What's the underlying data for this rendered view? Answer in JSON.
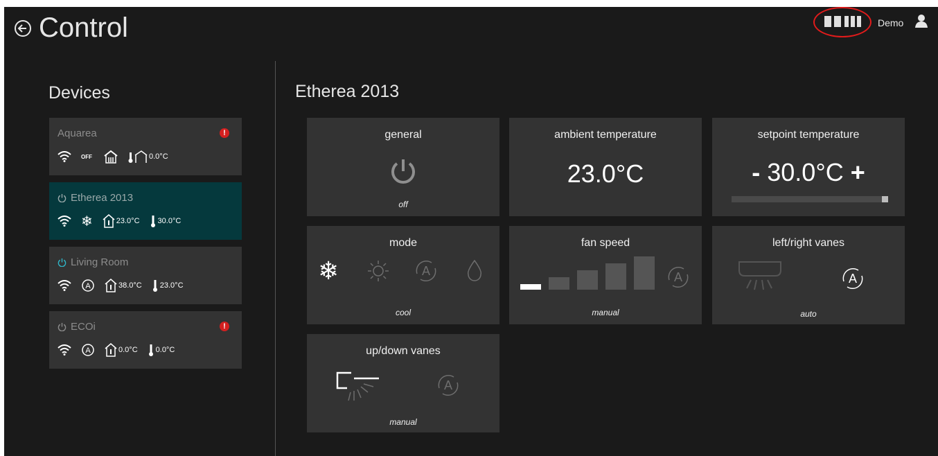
{
  "header": {
    "title": "Control",
    "back_icon": "back-arrow-circle-icon",
    "layout_icons": [
      "two-column-layout-icon",
      "three-column-layout-icon"
    ],
    "user_name": "Demo",
    "user_icon": "user-icon"
  },
  "sidebar": {
    "heading": "Devices",
    "devices": [
      {
        "name": "Aquarea",
        "alert": "!",
        "power_icon": false,
        "status": {
          "wifi": true,
          "mode": "OFF",
          "house_icon": "heat-house-icon",
          "indoor_temp": "0.0°C"
        }
      },
      {
        "name": "Etherea 2013",
        "alert": "",
        "power_icon": true,
        "selected": true,
        "status": {
          "wifi": true,
          "mode_icon": "snowflake-icon",
          "ambient_temp": "23.0°C",
          "setpoint_temp": "30.0°C"
        }
      },
      {
        "name": "Living Room",
        "alert": "",
        "power_icon": true,
        "power_on": true,
        "status": {
          "wifi": true,
          "mode_icon": "auto-mode-icon",
          "ambient_temp": "38.0°C",
          "setpoint_temp": "23.0°C"
        }
      },
      {
        "name": "ECOi",
        "alert": "!",
        "power_icon": true,
        "status": {
          "wifi": true,
          "mode_icon": "auto-mode-icon",
          "ambient_temp": "0.0°C",
          "setpoint_temp": "0.0°C"
        }
      }
    ]
  },
  "panel": {
    "title": "Etherea 2013",
    "tiles": {
      "general": {
        "title": "general",
        "value": "off",
        "icon": "power-icon"
      },
      "ambient": {
        "title": "ambient temperature",
        "value": "23.0°C"
      },
      "setpoint": {
        "title": "setpoint temperature",
        "minus": "-",
        "value": "30.0°C",
        "plus": "+",
        "slider_level_pct": 100
      },
      "mode": {
        "title": "mode",
        "value": "cool",
        "options": [
          "snowflake-icon",
          "sun-icon",
          "auto-mode-icon",
          "drop-icon"
        ],
        "selected": "snowflake-icon"
      },
      "fan": {
        "title": "fan speed",
        "value": "manual",
        "levels": 5,
        "selected_level": 1,
        "auto_icon": "auto-mode-icon"
      },
      "lr_vanes": {
        "title": "left/right vanes",
        "value": "auto",
        "icons": [
          "ac-unit-icon",
          "auto-mode-icon"
        ]
      },
      "ud_vanes": {
        "title": "up/down vanes",
        "value": "manual",
        "icons": [
          "ac-unit-icon",
          "auto-mode-icon"
        ]
      }
    }
  },
  "colors": {
    "background": "#1a1a1a",
    "tile": "#333333",
    "selected_device": "#05393d",
    "accent": "#2fb6c8",
    "alert": "#d42020",
    "highlight": "#e21b1b"
  }
}
